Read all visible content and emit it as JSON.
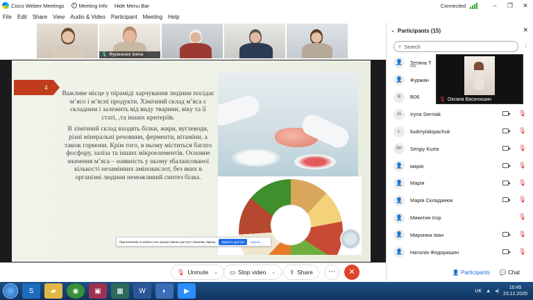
{
  "window": {
    "app_title": "Cisco Webex Meetings",
    "meeting_info": "Meeting Info",
    "hide_menu_bar": "Hide Menu Bar",
    "status": "Connected"
  },
  "menu": [
    "File",
    "Edit",
    "Share",
    "View",
    "Audio & Video",
    "Participant",
    "Meeting",
    "Help"
  ],
  "thumbnails": [
    {
      "name": ""
    },
    {
      "name": "Фурманюк Ірина"
    },
    {
      "name": ""
    },
    {
      "name": ""
    },
    {
      "name": ""
    }
  ],
  "slide": {
    "number": "4",
    "paragraph1": "Важливе місце у піраміді харчування людини посідає м’ясо і м’ясні продукти. Хімічний склад м’яса є складним і залежить від виду тварини, віку та її статі, ,та інших критеріїв.",
    "paragraph2": "В хімічний склад входять білки, жири, вуглеводи, різні мінеральні речовини, ферменти, вітаміни, а також гормони. Крім того, в ньому міститься багато фосфору, заліза та інших мікроелементів. Основне значення м’яса – наявність у ньому збалансованої кількості незамінних амінокислот, без яких в організмі людини неможливий синтез білка.",
    "share_notice": "Приложению ru.webex.com предоставлен доступ к вашему экрану.",
    "stop_share": "Закрыть доступ",
    "hide": "Скрыть"
  },
  "controls": {
    "unmute": "Unmute",
    "stop_video": "Stop video",
    "share": "Share",
    "more": "⋯"
  },
  "panel": {
    "title": "Participants (15)",
    "search_placeholder": "Search",
    "floating_name": "Оксана Василишин",
    "participants_tab": "Participants",
    "chat_tab": "Chat",
    "participants": [
      {
        "initials": "",
        "name": "Тетяна Т",
        "sub": "Me"
      },
      {
        "initials": "",
        "name": "Фурман",
        "sub": ""
      },
      {
        "initials": "B",
        "name": "B06",
        "sub": ""
      },
      {
        "initials": "IS",
        "name": "Iryna Serniak",
        "sub": ""
      },
      {
        "initials": "L",
        "name": "liudmylalopachuk",
        "sub": ""
      },
      {
        "initials": "SK",
        "name": "Sergiy Kurta",
        "sub": ""
      },
      {
        "initials": "",
        "name": "марія",
        "sub": ""
      },
      {
        "initials": "",
        "name": "Марія",
        "sub": ""
      },
      {
        "initials": "",
        "name": "Марія Складанюк",
        "sub": ""
      },
      {
        "initials": "",
        "name": "Микитин Ігор",
        "sub": ""
      },
      {
        "initials": "",
        "name": "Миронюк Іван",
        "sub": ""
      },
      {
        "initials": "",
        "name": "Наталія Федоришин",
        "sub": ""
      }
    ]
  },
  "taskbar": {
    "lang": "UK",
    "time": "10:45",
    "date": "23.12.2020"
  }
}
